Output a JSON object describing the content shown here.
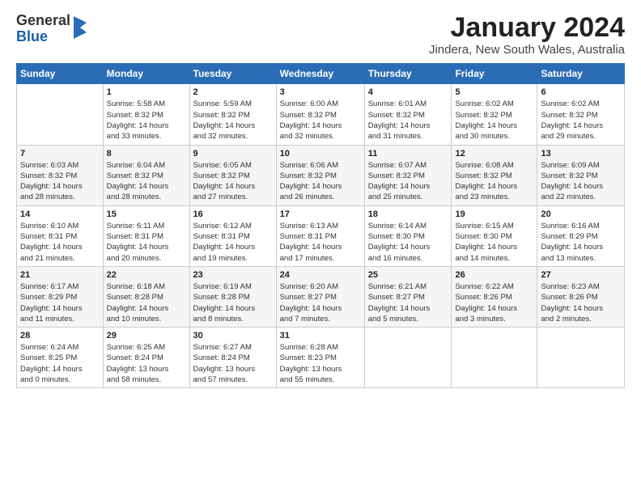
{
  "header": {
    "logo_general": "General",
    "logo_blue": "Blue",
    "month_title": "January 2024",
    "location": "Jindera, New South Wales, Australia"
  },
  "weekdays": [
    "Sunday",
    "Monday",
    "Tuesday",
    "Wednesday",
    "Thursday",
    "Friday",
    "Saturday"
  ],
  "weeks": [
    [
      {
        "day": "",
        "info": ""
      },
      {
        "day": "1",
        "info": "Sunrise: 5:58 AM\nSunset: 8:32 PM\nDaylight: 14 hours\nand 33 minutes."
      },
      {
        "day": "2",
        "info": "Sunrise: 5:59 AM\nSunset: 8:32 PM\nDaylight: 14 hours\nand 32 minutes."
      },
      {
        "day": "3",
        "info": "Sunrise: 6:00 AM\nSunset: 8:32 PM\nDaylight: 14 hours\nand 32 minutes."
      },
      {
        "day": "4",
        "info": "Sunrise: 6:01 AM\nSunset: 8:32 PM\nDaylight: 14 hours\nand 31 minutes."
      },
      {
        "day": "5",
        "info": "Sunrise: 6:02 AM\nSunset: 8:32 PM\nDaylight: 14 hours\nand 30 minutes."
      },
      {
        "day": "6",
        "info": "Sunrise: 6:02 AM\nSunset: 8:32 PM\nDaylight: 14 hours\nand 29 minutes."
      }
    ],
    [
      {
        "day": "7",
        "info": "Sunrise: 6:03 AM\nSunset: 8:32 PM\nDaylight: 14 hours\nand 28 minutes."
      },
      {
        "day": "8",
        "info": "Sunrise: 6:04 AM\nSunset: 8:32 PM\nDaylight: 14 hours\nand 28 minutes."
      },
      {
        "day": "9",
        "info": "Sunrise: 6:05 AM\nSunset: 8:32 PM\nDaylight: 14 hours\nand 27 minutes."
      },
      {
        "day": "10",
        "info": "Sunrise: 6:06 AM\nSunset: 8:32 PM\nDaylight: 14 hours\nand 26 minutes."
      },
      {
        "day": "11",
        "info": "Sunrise: 6:07 AM\nSunset: 8:32 PM\nDaylight: 14 hours\nand 25 minutes."
      },
      {
        "day": "12",
        "info": "Sunrise: 6:08 AM\nSunset: 8:32 PM\nDaylight: 14 hours\nand 23 minutes."
      },
      {
        "day": "13",
        "info": "Sunrise: 6:09 AM\nSunset: 8:32 PM\nDaylight: 14 hours\nand 22 minutes."
      }
    ],
    [
      {
        "day": "14",
        "info": "Sunrise: 6:10 AM\nSunset: 8:31 PM\nDaylight: 14 hours\nand 21 minutes."
      },
      {
        "day": "15",
        "info": "Sunrise: 6:11 AM\nSunset: 8:31 PM\nDaylight: 14 hours\nand 20 minutes."
      },
      {
        "day": "16",
        "info": "Sunrise: 6:12 AM\nSunset: 8:31 PM\nDaylight: 14 hours\nand 19 minutes."
      },
      {
        "day": "17",
        "info": "Sunrise: 6:13 AM\nSunset: 8:31 PM\nDaylight: 14 hours\nand 17 minutes."
      },
      {
        "day": "18",
        "info": "Sunrise: 6:14 AM\nSunset: 8:30 PM\nDaylight: 14 hours\nand 16 minutes."
      },
      {
        "day": "19",
        "info": "Sunrise: 6:15 AM\nSunset: 8:30 PM\nDaylight: 14 hours\nand 14 minutes."
      },
      {
        "day": "20",
        "info": "Sunrise: 6:16 AM\nSunset: 8:29 PM\nDaylight: 14 hours\nand 13 minutes."
      }
    ],
    [
      {
        "day": "21",
        "info": "Sunrise: 6:17 AM\nSunset: 8:29 PM\nDaylight: 14 hours\nand 11 minutes."
      },
      {
        "day": "22",
        "info": "Sunrise: 6:18 AM\nSunset: 8:28 PM\nDaylight: 14 hours\nand 10 minutes."
      },
      {
        "day": "23",
        "info": "Sunrise: 6:19 AM\nSunset: 8:28 PM\nDaylight: 14 hours\nand 8 minutes."
      },
      {
        "day": "24",
        "info": "Sunrise: 6:20 AM\nSunset: 8:27 PM\nDaylight: 14 hours\nand 7 minutes."
      },
      {
        "day": "25",
        "info": "Sunrise: 6:21 AM\nSunset: 8:27 PM\nDaylight: 14 hours\nand 5 minutes."
      },
      {
        "day": "26",
        "info": "Sunrise: 6:22 AM\nSunset: 8:26 PM\nDaylight: 14 hours\nand 3 minutes."
      },
      {
        "day": "27",
        "info": "Sunrise: 6:23 AM\nSunset: 8:26 PM\nDaylight: 14 hours\nand 2 minutes."
      }
    ],
    [
      {
        "day": "28",
        "info": "Sunrise: 6:24 AM\nSunset: 8:25 PM\nDaylight: 14 hours\nand 0 minutes."
      },
      {
        "day": "29",
        "info": "Sunrise: 6:25 AM\nSunset: 8:24 PM\nDaylight: 13 hours\nand 58 minutes."
      },
      {
        "day": "30",
        "info": "Sunrise: 6:27 AM\nSunset: 8:24 PM\nDaylight: 13 hours\nand 57 minutes."
      },
      {
        "day": "31",
        "info": "Sunrise: 6:28 AM\nSunset: 8:23 PM\nDaylight: 13 hours\nand 55 minutes."
      },
      {
        "day": "",
        "info": ""
      },
      {
        "day": "",
        "info": ""
      },
      {
        "day": "",
        "info": ""
      }
    ]
  ]
}
